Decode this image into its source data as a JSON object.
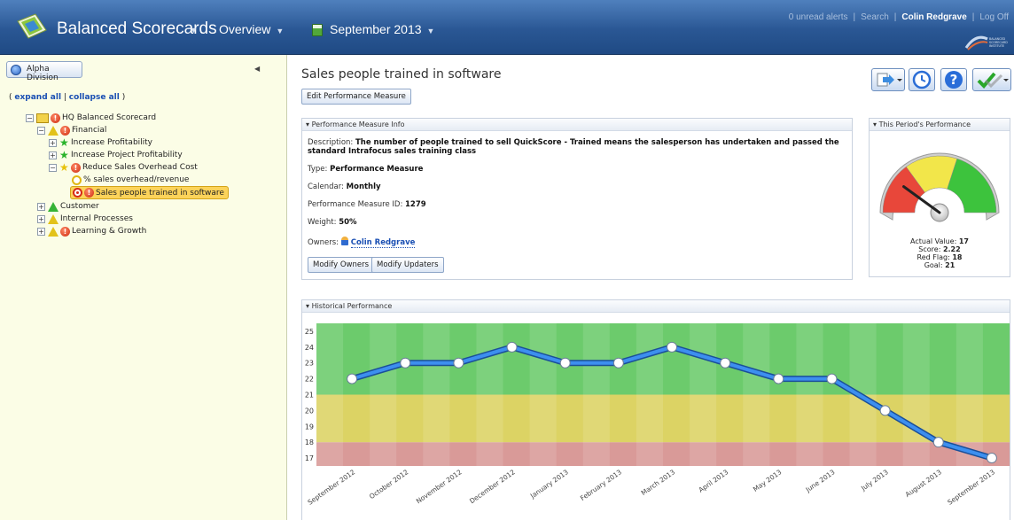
{
  "header": {
    "app_title": "Balanced Scorecards",
    "overview_label": "Overview",
    "period_label": "September 2013",
    "alerts": "0 unread alerts",
    "search": "Search",
    "user": "Colin Redgrave",
    "logoff": "Log Off",
    "brand_text": "BALANCED SCORECARD INSTITUTE"
  },
  "sidebar": {
    "division": "Alpha Division",
    "expand_all": "expand all",
    "collapse_all": "collapse all",
    "tree": [
      {
        "label": "HQ Balanced Scorecard",
        "icons": [
          "scorecard-icon",
          "red-flag-icon"
        ]
      },
      {
        "label": "Financial",
        "icons": [
          "yellow-triangle-icon",
          "red-flag-icon"
        ]
      },
      {
        "label": "Increase Profitability",
        "icons": [
          "green-star-icon"
        ]
      },
      {
        "label": "Increase Project Profitability",
        "icons": [
          "green-star-icon"
        ]
      },
      {
        "label": "Reduce Sales Overhead Cost",
        "icons": [
          "yellow-star-icon",
          "red-flag-icon"
        ]
      },
      {
        "label": "% sales overhead/revenue",
        "icons": [
          "yellow-circle-icon"
        ]
      },
      {
        "label": "Sales people trained in software",
        "icons": [
          "red-target-icon",
          "red-flag-icon"
        ]
      },
      {
        "label": "Customer",
        "icons": [
          "green-triangle-icon"
        ]
      },
      {
        "label": "Internal Processes",
        "icons": [
          "yellow-triangle-icon"
        ]
      },
      {
        "label": "Learning & Growth",
        "icons": [
          "yellow-triangle-icon",
          "red-flag-icon"
        ]
      }
    ]
  },
  "main": {
    "title": "Sales people trained in software",
    "edit_button": "Edit Performance Measure",
    "info_panel": {
      "title": "Performance Measure Info",
      "description_label": "Description:",
      "description": "The number of people trained to sell QuickScore - Trained means the salesperson has undertaken and passed the standard Intrafocus sales training class",
      "type_label": "Type:",
      "type": "Performance Measure",
      "calendar_label": "Calendar:",
      "calendar": "Monthly",
      "id_label": "Performance Measure ID:",
      "id": "1279",
      "weight_label": "Weight:",
      "weight": "50%",
      "owners_label": "Owners:",
      "owner": "Colin Redgrave",
      "modify_owners": "Modify Owners",
      "modify_updaters": "Modify Updaters"
    },
    "period_panel": {
      "title": "This Period's Performance",
      "actual_label": "Actual Value:",
      "actual": "17",
      "score_label": "Score:",
      "score": "2.22",
      "red_flag_label": "Red Flag:",
      "red_flag": "18",
      "goal_label": "Goal:",
      "goal": "21"
    },
    "history_panel": {
      "title": "Historical Performance"
    }
  },
  "colors": {
    "band_green": "#6ccb6c",
    "band_yellow": "#dcd364",
    "band_red": "#d99a98",
    "line": "#2f7ee6"
  },
  "chart_data": {
    "type": "line",
    "categories": [
      "September 2012",
      "October 2012",
      "November 2012",
      "December 2012",
      "January 2013",
      "February 2013",
      "March 2013",
      "April 2013",
      "May 2013",
      "June 2013",
      "July 2013",
      "August 2013",
      "September 2013"
    ],
    "values": [
      22,
      23,
      23,
      24,
      23,
      23,
      24,
      23,
      22,
      22,
      20,
      18,
      17
    ],
    "y_ticks": [
      17,
      18,
      19,
      20,
      21,
      22,
      23,
      24,
      25
    ],
    "ylim": [
      16.5,
      25.5
    ],
    "bands": [
      {
        "from": 16.5,
        "to": 18,
        "color": "red"
      },
      {
        "from": 18,
        "to": 21,
        "color": "yellow"
      },
      {
        "from": 21,
        "to": 25.5,
        "color": "green"
      }
    ],
    "gauge_value": 17,
    "gauge_min": 15,
    "gauge_max": 25,
    "gauge_red_flag": 18,
    "gauge_goal": 21
  }
}
